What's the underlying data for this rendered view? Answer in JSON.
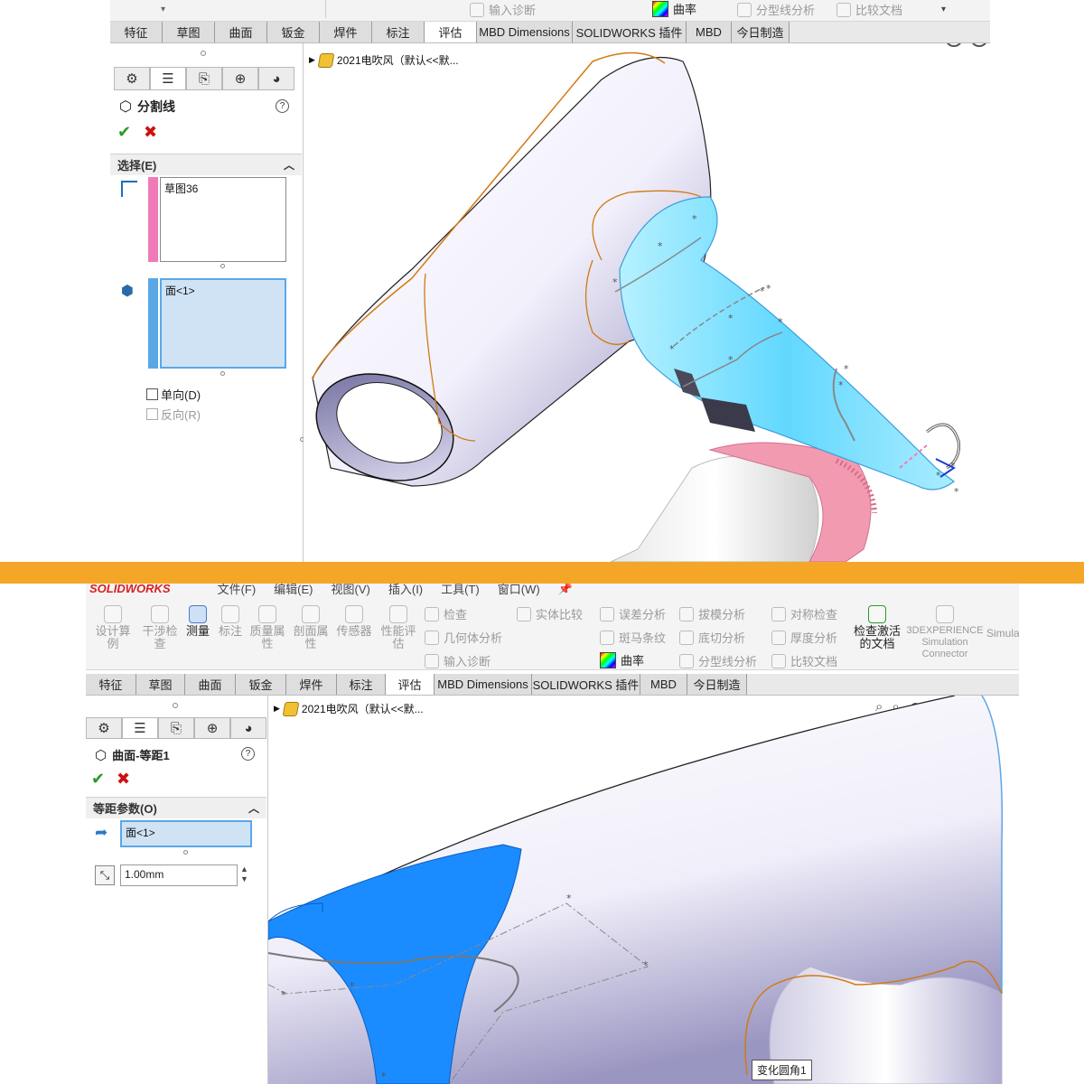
{
  "top": {
    "ribbon": {
      "input_diagnosis": "输入诊断",
      "curvature": "曲率",
      "parting_line_analysis": "分型线分析",
      "compare_documents": "比较文档"
    },
    "tabs": [
      "特征",
      "草图",
      "曲面",
      "钣金",
      "焊件",
      "标注",
      "评估",
      "MBD Dimensions",
      "SOLIDWORKS 插件",
      "MBD",
      "今日制造"
    ],
    "active_tab": "评估",
    "tree_root": "2021电吹风（默认<<默...",
    "property_manager": {
      "title": "分割线",
      "help": "?",
      "ok": "✔",
      "cancel": "✖",
      "group_title": "选择(E)",
      "sketch_box_value": "草图36",
      "face_box_value": "面<1>",
      "single_direction": "单向(D)",
      "reverse_direction": "反向(R)"
    }
  },
  "bottom": {
    "menu": {
      "logo": "SOLIDWORKS",
      "items": [
        "文件(F)",
        "编辑(E)",
        "视图(V)",
        "插入(I)",
        "工具(T)",
        "窗口(W)"
      ]
    },
    "ribbon": {
      "design_study": "设计算例",
      "interference": "干涉检查",
      "measure": "测量",
      "markup": "标注",
      "mass_props": "质量属性",
      "section_props": "剖面属性",
      "sensor": "传感器",
      "perf_eval": "性能评估",
      "check": "检查",
      "geometry_analysis": "几何体分析",
      "input_diagnosis": "输入诊断",
      "solid_compare": "实体比较",
      "deviation": "误差分析",
      "zebra": "斑马条纹",
      "curvature": "曲率",
      "draft": "拔模分析",
      "undercut": "底切分析",
      "parting_line": "分型线分析",
      "symmetry": "对称检查",
      "thickness": "厚度分析",
      "compare_docs": "比较文档",
      "check_active": "检查激活的文档",
      "experience_line1": "3DEXPERIENCE",
      "experience_line2": "Simulation",
      "experience_line3": "Connector",
      "simulation": "Simulat 分析"
    },
    "tabs": [
      "特征",
      "草图",
      "曲面",
      "钣金",
      "焊件",
      "标注",
      "评估",
      "MBD Dimensions",
      "SOLIDWORKS 插件",
      "MBD",
      "今日制造"
    ],
    "active_tab": "评估",
    "tree_root": "2021电吹风（默认<<默...",
    "property_manager": {
      "title": "曲面-等距1",
      "help": "?",
      "ok": "✔",
      "cancel": "✖",
      "group_title": "等距参数(O)",
      "face_box_value": "面<1>",
      "distance_value": "1.00mm"
    },
    "tooltip": "变化圆角1"
  },
  "colors": {
    "separator": "#f5a627",
    "accent_blue": "#5aa7e8",
    "sketch_pink": "#f07ab8",
    "curve_orange": "#d17a13",
    "surface_cyan": "#6fdcff",
    "offset_blue": "#1a8cff"
  }
}
